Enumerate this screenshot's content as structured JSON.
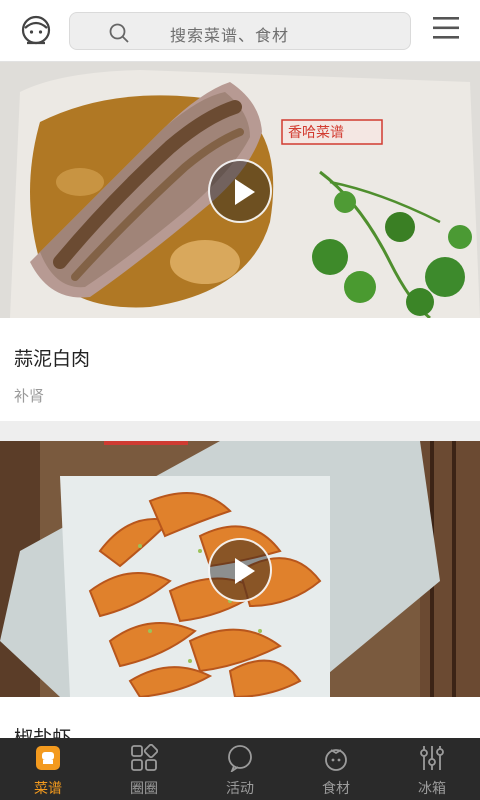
{
  "header": {
    "search_placeholder": "搜索菜谱、食材",
    "icons": {
      "avatar": "chef-avatar-icon",
      "search": "search-icon",
      "menu": "hamburger-menu-icon"
    }
  },
  "feed": {
    "cards": [
      {
        "title": "蒜泥白肉",
        "tag": "补肾",
        "watermark": "香哈菜谱"
      },
      {
        "title": "椒盐虾"
      }
    ]
  },
  "nav": {
    "items": [
      {
        "label": "菜谱",
        "icon": "recipe-book-icon",
        "active": true
      },
      {
        "label": "圈圈",
        "icon": "grid-circle-icon",
        "active": false
      },
      {
        "label": "活动",
        "icon": "chat-bubble-icon",
        "active": false
      },
      {
        "label": "食材",
        "icon": "tomato-icon",
        "active": false
      },
      {
        "label": "冰箱",
        "icon": "fridge-sliders-icon",
        "active": false
      }
    ]
  },
  "colors": {
    "accent": "#f39a1e",
    "nav_bg": "#2a2a2a",
    "header_bg": "#ffffff"
  }
}
